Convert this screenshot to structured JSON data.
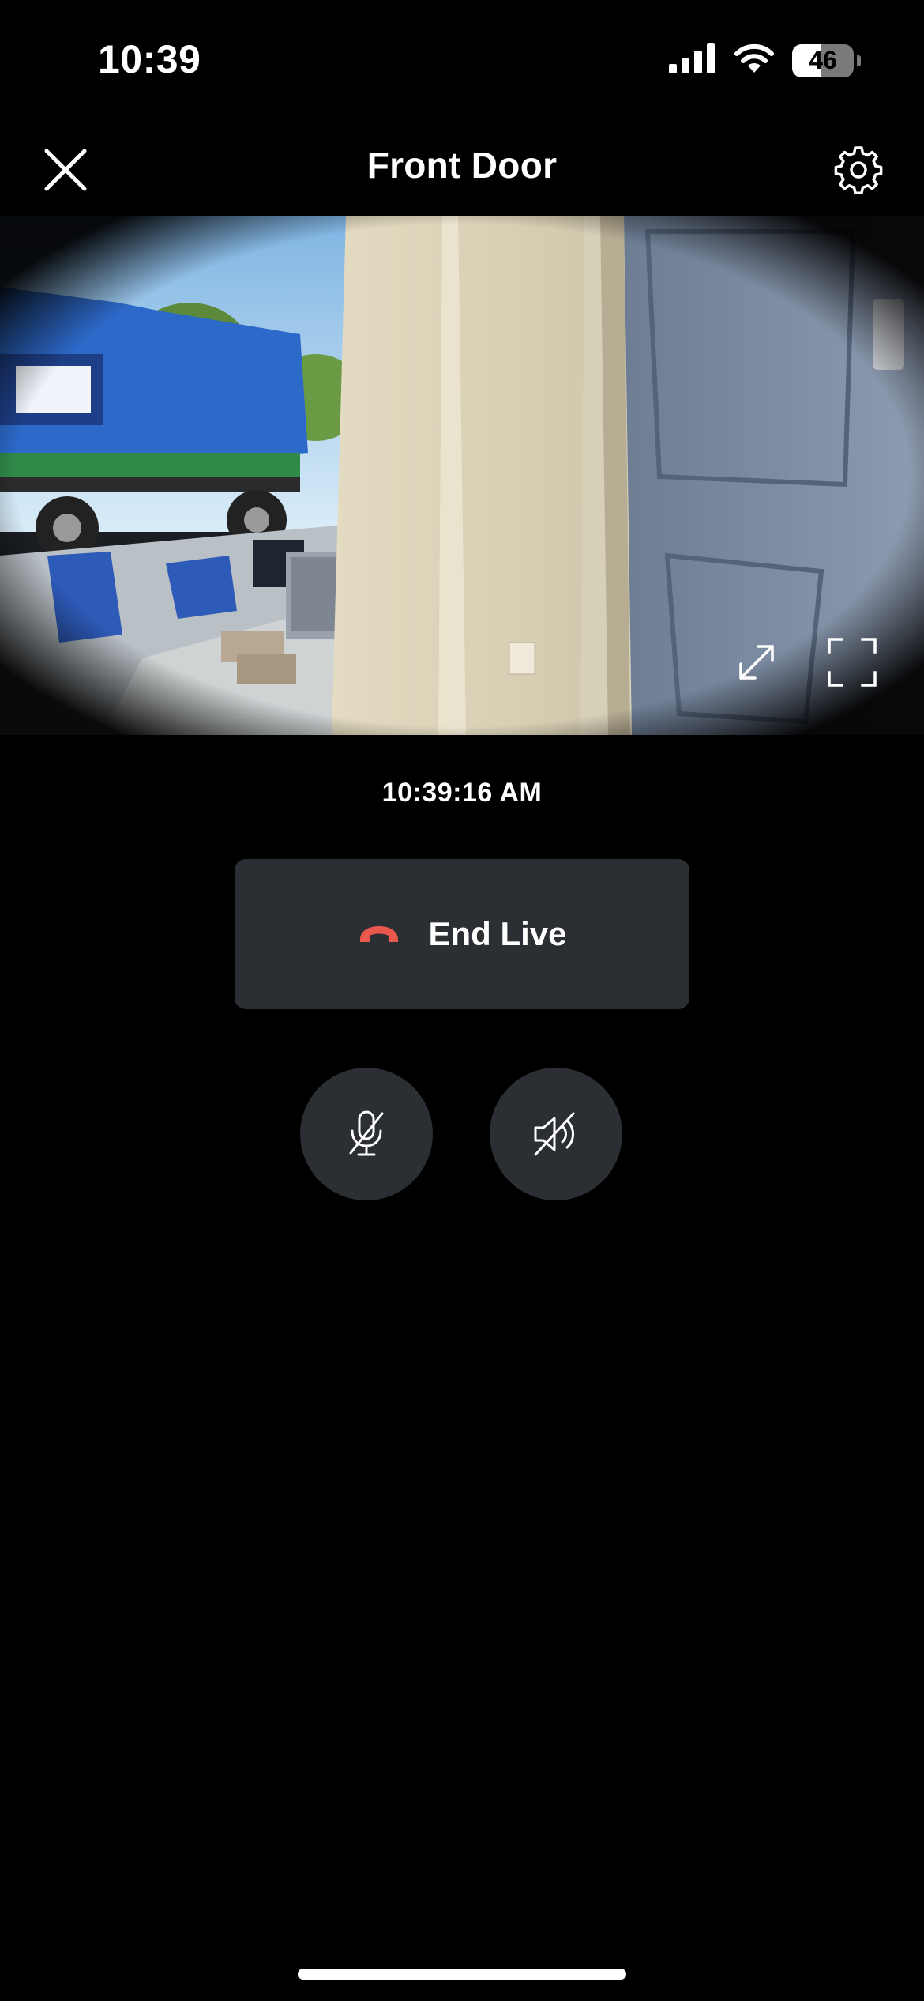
{
  "status_bar": {
    "time": "10:39",
    "battery_level": "46",
    "battery_fraction": 0.46,
    "icons": [
      "cellular-signal-icon",
      "wifi-icon",
      "battery-icon"
    ]
  },
  "header": {
    "title": "Front Door",
    "close_icon": "close-icon",
    "settings_icon": "gear-icon"
  },
  "video": {
    "controls": [
      "expand-icon",
      "fullscreen-icon"
    ]
  },
  "timestamp": "10:39:16 AM",
  "end_live": {
    "label": "End Live",
    "icon": "phone-hangup-icon"
  },
  "audio_controls": {
    "mic_icon": "microphone-muted-icon",
    "speaker_icon": "speaker-muted-icon"
  },
  "colors": {
    "background": "#000000",
    "button_surface": "#2b2e33",
    "hangup_red": "#e8584c",
    "text": "#ffffff"
  }
}
